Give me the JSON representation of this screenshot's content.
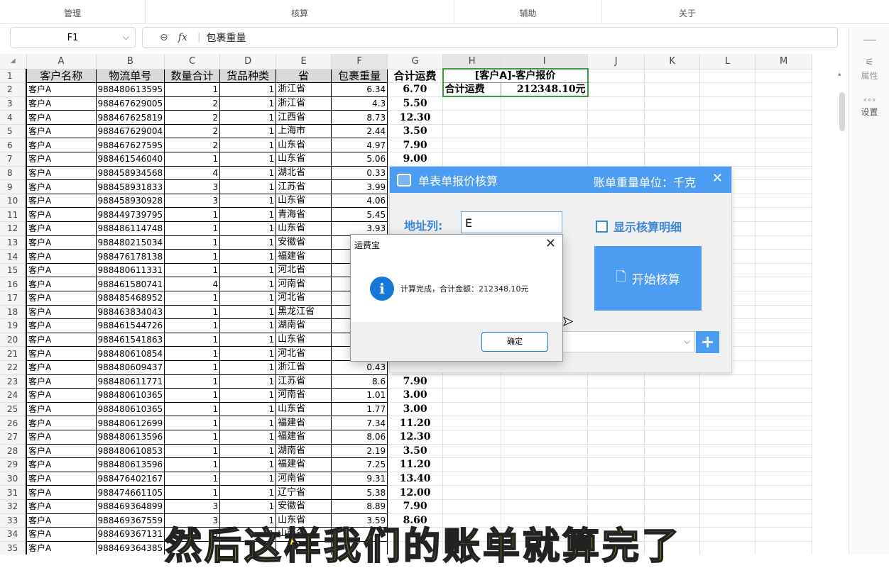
{
  "ribbon": {
    "groups": [
      "管理",
      "核算",
      "辅助",
      "关于"
    ]
  },
  "formula_bar": {
    "cell_ref": "F1",
    "zoom_icon": "⊖",
    "fx": "fx",
    "content": "包裹重量"
  },
  "columns": [
    "A",
    "B",
    "C",
    "D",
    "E",
    "F",
    "G",
    "H",
    "I",
    "J",
    "K",
    "L",
    "M"
  ],
  "headers": [
    "客户名称",
    "物流单号",
    "数量合计",
    "货品种类",
    "省",
    "包裹重量",
    "合计运费"
  ],
  "quote_box": {
    "title": "[客户A]-客户报价",
    "label": "合计运费",
    "value": "212348.10元"
  },
  "rows": [
    [
      "1",
      "客户A",
      "988480613595",
      "1",
      "1",
      "浙江省",
      "6.34",
      "6.70"
    ],
    [
      "2",
      "客户A",
      "988467629005",
      "2",
      "1",
      "浙江省",
      "4.3",
      "5.50"
    ],
    [
      "3",
      "客户A",
      "988467625819",
      "2",
      "1",
      "江西省",
      "8.73",
      "12.30"
    ],
    [
      "4",
      "客户A",
      "988467629004",
      "2",
      "1",
      "上海市",
      "2.44",
      "3.50"
    ],
    [
      "5",
      "客户A",
      "988467627595",
      "2",
      "1",
      "山东省",
      "4.97",
      "7.90"
    ],
    [
      "6",
      "客户A",
      "988461546040",
      "1",
      "1",
      "山东省",
      "5.06",
      "9.00"
    ],
    [
      "7",
      "客户A",
      "988458934568",
      "4",
      "1",
      "湖北省",
      "0.33",
      ""
    ],
    [
      "8",
      "客户A",
      "988458931833",
      "3",
      "1",
      "江苏省",
      "3.99",
      ""
    ],
    [
      "9",
      "客户A",
      "988458930928",
      "3",
      "1",
      "山东省",
      "4.06",
      ""
    ],
    [
      "10",
      "客户A",
      "988449739795",
      "1",
      "1",
      "青海省",
      "5.45",
      ""
    ],
    [
      "11",
      "客户A",
      "988486114748",
      "1",
      "1",
      "山东省",
      "3.93",
      ""
    ],
    [
      "12",
      "客户A",
      "988480215034",
      "1",
      "1",
      "安徽省",
      "",
      ""
    ],
    [
      "13",
      "客户A",
      "988476178138",
      "1",
      "1",
      "福建省",
      "",
      ""
    ],
    [
      "14",
      "客户A",
      "988480611331",
      "1",
      "1",
      "河北省",
      "",
      ""
    ],
    [
      "15",
      "客户A",
      "988461580741",
      "4",
      "1",
      "河南省",
      "",
      ""
    ],
    [
      "16",
      "客户A",
      "988485468952",
      "1",
      "1",
      "河北省",
      "",
      ""
    ],
    [
      "17",
      "客户A",
      "988463834043",
      "1",
      "1",
      "黑龙江省",
      "",
      ""
    ],
    [
      "18",
      "客户A",
      "988461544726",
      "1",
      "1",
      "湖南省",
      "",
      ""
    ],
    [
      "19",
      "客户A",
      "988461541863",
      "1",
      "1",
      "山东省",
      "",
      ""
    ],
    [
      "20",
      "客户A",
      "988480610854",
      "1",
      "1",
      "河北省",
      "",
      ""
    ],
    [
      "21",
      "客户A",
      "988480609437",
      "1",
      "1",
      "浙江省",
      "0.43",
      ""
    ],
    [
      "22",
      "客户A",
      "988480611771",
      "1",
      "1",
      "江苏省",
      "8.6",
      "7.90"
    ],
    [
      "23",
      "客户A",
      "988480610365",
      "1",
      "1",
      "河南省",
      "1.01",
      "3.00"
    ],
    [
      "24",
      "客户A",
      "988480610365",
      "1",
      "1",
      "山东省",
      "1.77",
      "3.00"
    ],
    [
      "25",
      "客户A",
      "988480612699",
      "1",
      "1",
      "福建省",
      "7.34",
      "11.20"
    ],
    [
      "26",
      "客户A",
      "988480613596",
      "1",
      "1",
      "福建省",
      "8.06",
      "12.30"
    ],
    [
      "27",
      "客户A",
      "988480610853",
      "1",
      "1",
      "湖南省",
      "2.19",
      "3.50"
    ],
    [
      "28",
      "客户A",
      "988480613596",
      "1",
      "1",
      "福建省",
      "7.25",
      "11.20"
    ],
    [
      "29",
      "客户A",
      "988476402167",
      "1",
      "1",
      "河南省",
      "9.31",
      "13.40"
    ],
    [
      "30",
      "客户A",
      "988474661105",
      "1",
      "1",
      "辽宁省",
      "5.38",
      "12.00"
    ],
    [
      "31",
      "客户A",
      "988469364899",
      "3",
      "1",
      "安徽省",
      "8.89",
      "7.90"
    ],
    [
      "32",
      "客户A",
      "988469367559",
      "3",
      "1",
      "山东省",
      "3.59",
      "8.60"
    ],
    [
      "33",
      "客户A",
      "988469367131",
      "3",
      "1",
      "山西省",
      "",
      ""
    ],
    [
      "34",
      "客户A",
      "988469364385",
      "",
      "",
      "",
      "",
      ""
    ]
  ],
  "sidebar": {
    "items": [
      {
        "icon": "⚟",
        "label": "属性"
      },
      {
        "icon": "∘∘∘",
        "label": "设置"
      }
    ]
  },
  "quote_dialog": {
    "title": "单表单报价核算",
    "weight_unit": "账单重量单位：千克",
    "close": "✕",
    "address_label": "地址列:",
    "address_value": "E",
    "show_detail": "显示核算明细",
    "start_button": "开始核算",
    "start_icon": "🗋",
    "plus": "+"
  },
  "message_box": {
    "title": "运费宝",
    "close": "✕",
    "icon_glyph": "i",
    "text": "计算完成，合计金额：212348.10元",
    "ok": "确定"
  },
  "caption": "然后这样我们的账单就算完了",
  "colors": {
    "accent": "#4c9cf1",
    "info": "#1677d9",
    "caption": "#ffe51c",
    "selection": "#3d9a3d"
  }
}
